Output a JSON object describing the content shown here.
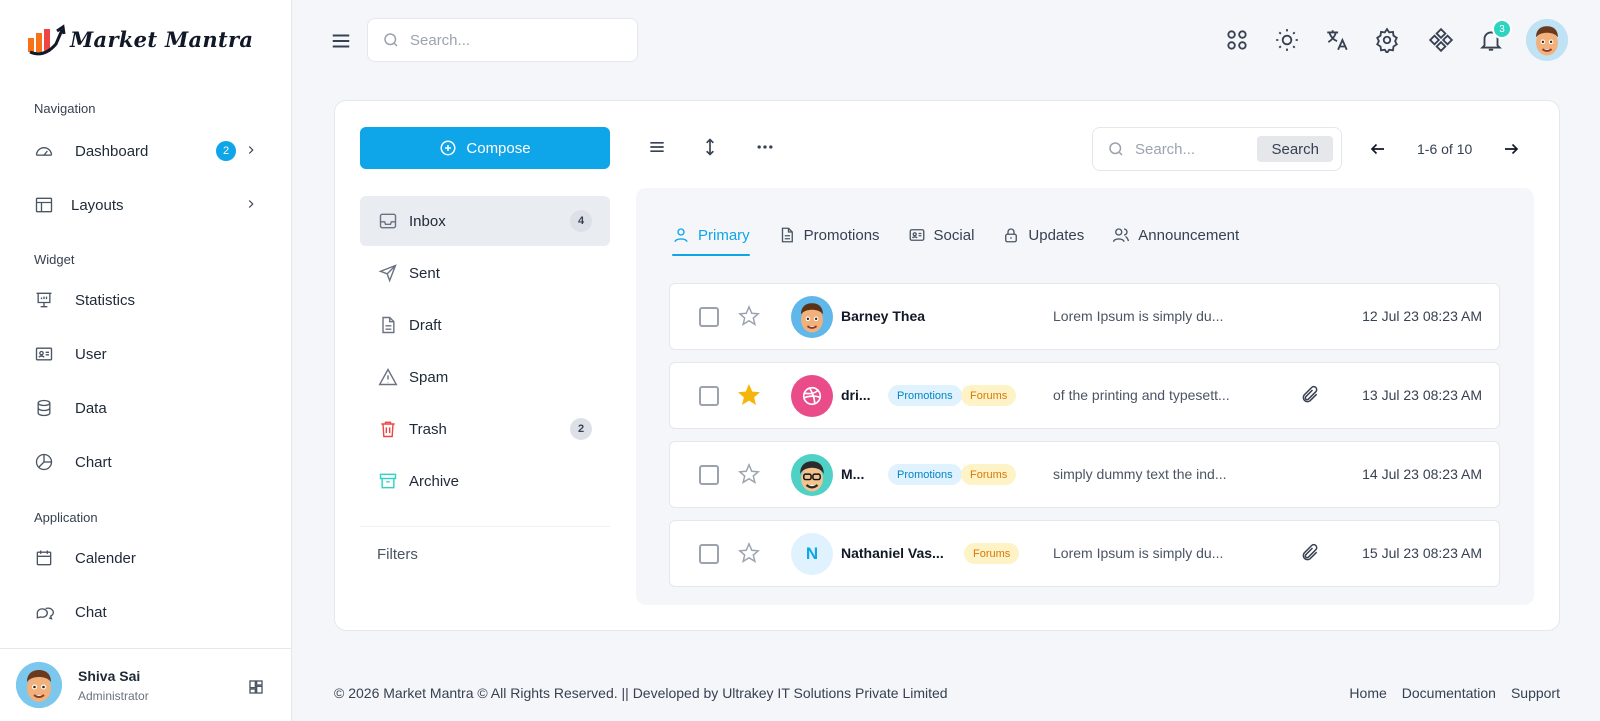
{
  "brand": {
    "name": "Market Mantra"
  },
  "sidebar": {
    "sections": [
      "Navigation",
      "Widget",
      "Application"
    ],
    "items": [
      {
        "label": "Dashboard",
        "icon": "gauge-icon",
        "badge": "2"
      },
      {
        "label": "Layouts",
        "icon": "layout-icon"
      },
      {
        "label": "Statistics",
        "icon": "presentation-icon"
      },
      {
        "label": "User",
        "icon": "id-card-icon"
      },
      {
        "label": "Data",
        "icon": "database-icon"
      },
      {
        "label": "Chart",
        "icon": "pie-chart-icon"
      },
      {
        "label": "Calender",
        "icon": "calendar-icon"
      },
      {
        "label": "Chat",
        "icon": "chat-icon"
      }
    ],
    "user": {
      "name": "Shiva Sai",
      "role": "Administrator"
    }
  },
  "header": {
    "search_placeholder": "Search...",
    "notification_count": "3"
  },
  "mail": {
    "compose_label": "Compose",
    "search_placeholder": "Search...",
    "search_button": "Search",
    "pager": "1-6 of 10",
    "folders": [
      {
        "label": "Inbox",
        "count": "4"
      },
      {
        "label": "Sent"
      },
      {
        "label": "Draft"
      },
      {
        "label": "Spam"
      },
      {
        "label": "Trash",
        "count": "2"
      },
      {
        "label": "Archive"
      }
    ],
    "filters_label": "Filters",
    "tabs": [
      "Primary",
      "Promotions",
      "Social",
      "Updates",
      "Announcement"
    ],
    "rows": [
      {
        "sender": "Barney Thea",
        "preview": "Lorem Ipsum is simply du...",
        "date": "12 Jul 23 08:23 AM",
        "starred": false
      },
      {
        "sender": "dri...",
        "tags": [
          "Promotions",
          "Forums"
        ],
        "preview": "of the printing and typesett...",
        "date": "13 Jul 23 08:23 AM",
        "starred": true
      },
      {
        "sender": "M...",
        "tags": [
          "Promotions",
          "Forums"
        ],
        "preview": "simply dummy text the ind...",
        "date": "14 Jul 23 08:23 AM",
        "starred": false
      },
      {
        "sender": "Nathaniel Vas...",
        "initial": "N",
        "tags": [
          "Forums"
        ],
        "preview": "Lorem Ipsum is simply du...",
        "date": "15 Jul 23 08:23 AM",
        "starred": false
      }
    ]
  },
  "footer": {
    "copyright": "© 2026 Market Mantra © All Rights Reserved. || Developed by Ultrakey IT Solutions Private Limited",
    "links": [
      "Home",
      "Documentation",
      "Support"
    ]
  },
  "colors": {
    "accent": "#0ea5e9",
    "star": "#f5b50a",
    "badge_teal": "#2dd4bf"
  }
}
